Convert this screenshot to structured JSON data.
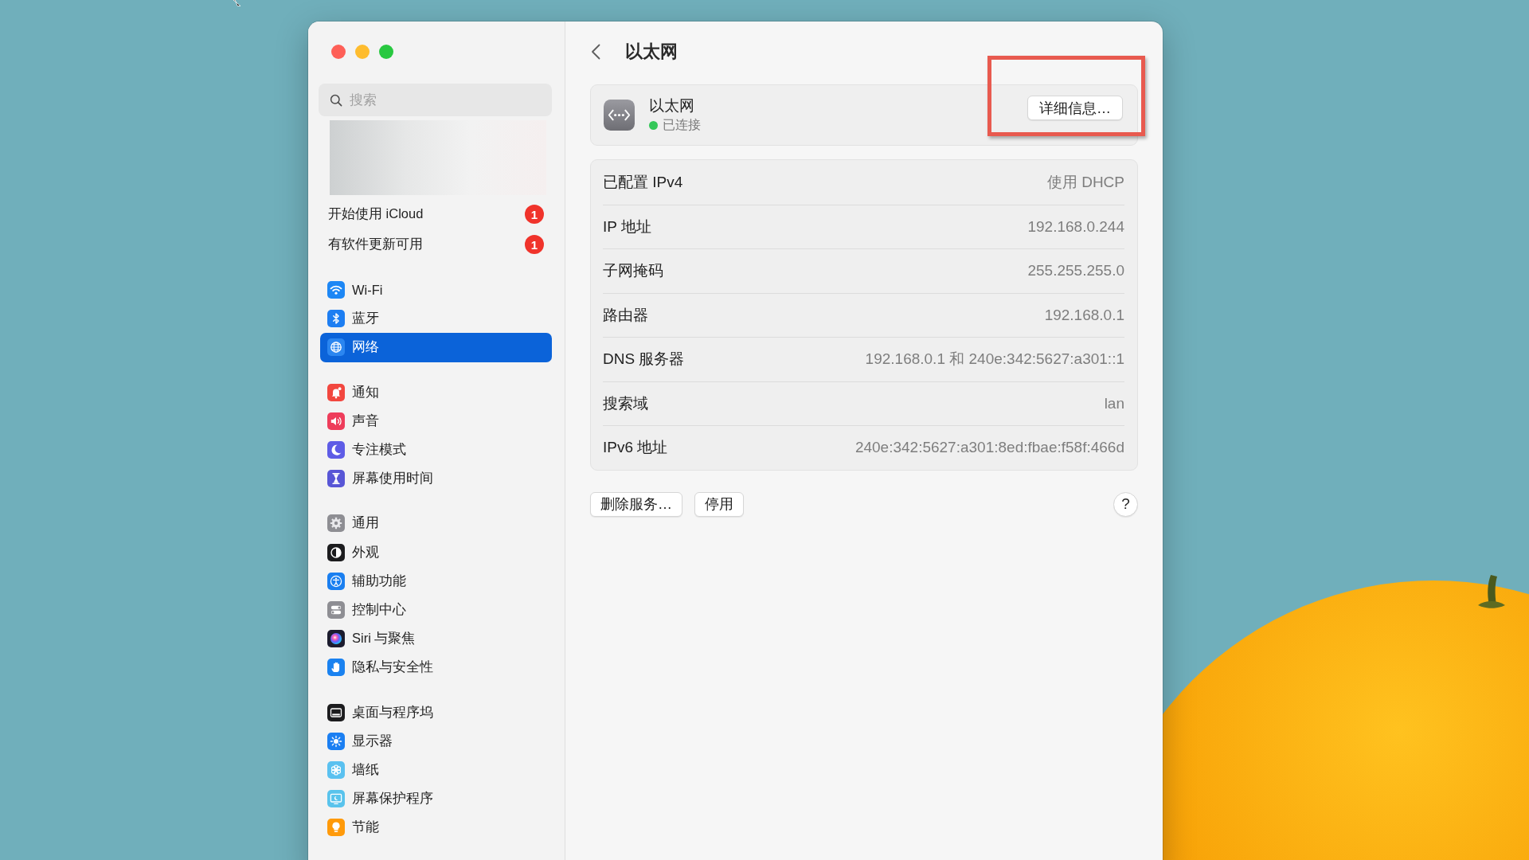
{
  "window": {
    "title": "以太网"
  },
  "sidebar": {
    "search": {
      "placeholder": "搜索"
    },
    "groups": [
      {
        "items": [
          {
            "kind": "notice",
            "label": "开始使用 iCloud",
            "badge": "1",
            "selected": false
          },
          {
            "kind": "notice",
            "label": "有软件更新可用",
            "badge": "1",
            "selected": false
          }
        ]
      },
      {
        "items": [
          {
            "kind": "wifi",
            "label": "Wi-Fi",
            "selected": false
          },
          {
            "kind": "bluetooth",
            "label": "蓝牙",
            "selected": false
          },
          {
            "kind": "network",
            "label": "网络",
            "selected": true
          }
        ]
      },
      {
        "items": [
          {
            "kind": "notifications",
            "label": "通知",
            "selected": false
          },
          {
            "kind": "sound",
            "label": "声音",
            "selected": false
          },
          {
            "kind": "focus",
            "label": "专注模式",
            "selected": false
          },
          {
            "kind": "screentime",
            "label": "屏幕使用时间",
            "selected": false
          }
        ]
      },
      {
        "items": [
          {
            "kind": "general",
            "label": "通用",
            "selected": false
          },
          {
            "kind": "appearance",
            "label": "外观",
            "selected": false
          },
          {
            "kind": "accessibility",
            "label": "辅助功能",
            "selected": false
          },
          {
            "kind": "controlcenter",
            "label": "控制中心",
            "selected": false
          },
          {
            "kind": "siri",
            "label": "Siri 与聚焦",
            "selected": false
          },
          {
            "kind": "privacy",
            "label": "隐私与安全性",
            "selected": false
          }
        ]
      },
      {
        "items": [
          {
            "kind": "desktop",
            "label": "桌面与程序坞",
            "selected": false
          },
          {
            "kind": "displays",
            "label": "显示器",
            "selected": false
          },
          {
            "kind": "wallpaper",
            "label": "墙纸",
            "selected": false
          },
          {
            "kind": "screensaver",
            "label": "屏幕保护程序",
            "selected": false
          },
          {
            "kind": "energy",
            "label": "节能",
            "selected": false
          }
        ]
      }
    ]
  },
  "service": {
    "name": "以太网",
    "status": "已连接",
    "connected": true,
    "details_button": "详细信息…",
    "details_highlighted": true
  },
  "details": [
    {
      "label": "已配置 IPv4",
      "value": "使用 DHCP"
    },
    {
      "label": "IP 地址",
      "value": "192.168.0.244"
    },
    {
      "label": "子网掩码",
      "value": "255.255.255.0"
    },
    {
      "label": "路由器",
      "value": "192.168.0.1"
    },
    {
      "label": "DNS 服务器",
      "value": "192.168.0.1 和 240e:342:5627:a301::1"
    },
    {
      "label": "搜索域",
      "value": "lan"
    },
    {
      "label": "IPv6 地址",
      "value": "240e:342:5627:a301:8ed:fbae:f58f:466d"
    }
  ],
  "actions": [
    "删除服务…",
    "停用"
  ],
  "help": "?"
}
